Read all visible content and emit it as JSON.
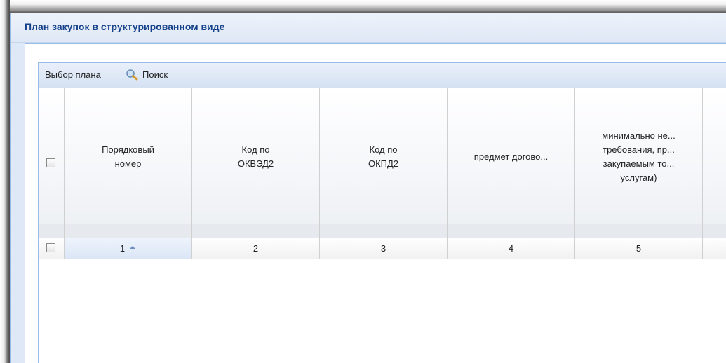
{
  "window": {
    "title": "План закупок в структурированном виде"
  },
  "toolbar": {
    "select_plan_label": "Выбор плана",
    "search_label": "Поиск",
    "search_icon": "search-icon"
  },
  "grid": {
    "columns": [
      {
        "label": "Порядковый\nномер"
      },
      {
        "label": "Код по\nОКВЭД2"
      },
      {
        "label": "Код по\nОКПД2"
      },
      {
        "label": "предмет догово..."
      },
      {
        "label": "минимально не...\nтребования, пр...\nзакупаемым то...\nуслугам)"
      }
    ],
    "number_row": [
      "1",
      "2",
      "3",
      "4",
      "5"
    ],
    "sorted_column_index": 0,
    "sort_direction": "ascending"
  },
  "colors": {
    "title": "#15428b",
    "panel_bg": "#dfe8f6",
    "border": "#99bbe8"
  }
}
